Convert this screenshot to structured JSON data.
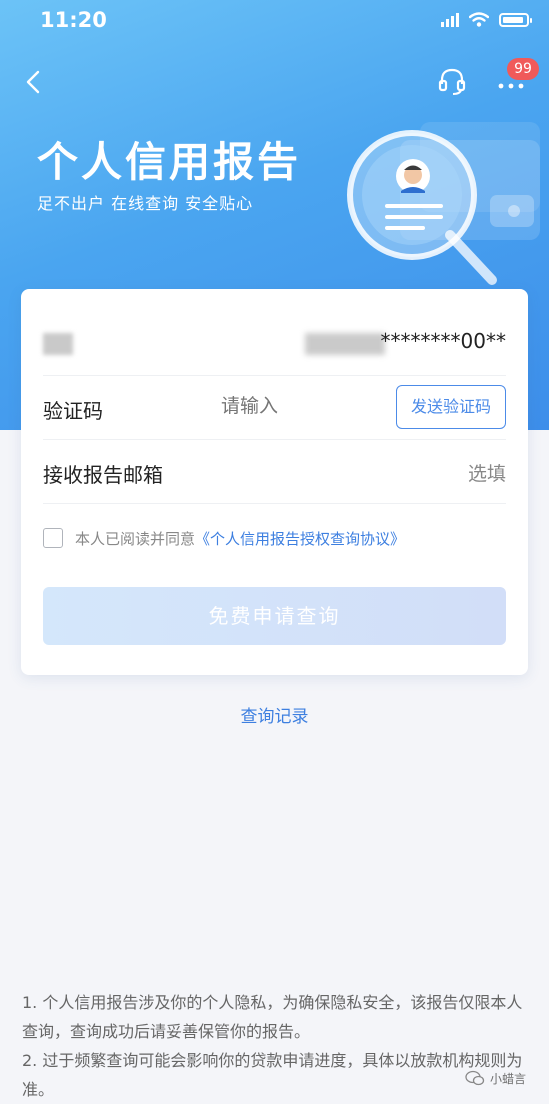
{
  "status": {
    "time": "11:20"
  },
  "nav": {
    "badge": "99"
  },
  "hero": {
    "title": "个人信用报告",
    "subtitle": "足不出户 在线查询 安全贴心"
  },
  "form": {
    "id_masked": "********00**",
    "code_label": "验证码",
    "code_placeholder": "请输入",
    "send_label": "发送验证码",
    "email_label": "接收报告邮箱",
    "email_placeholder": "选填",
    "agree_text": "本人已阅读并同意",
    "agree_link": "《个人信用报告授权查询协议》",
    "submit_label": "免费申请查询"
  },
  "records_label": "查询记录",
  "notes": [
    "1. 个人信用报告涉及你的个人隐私，为确保隐私安全，该报告仅限本人查询，查询成功后请妥善保管你的报告。",
    "2. 过于频繁查询可能会影响你的贷款申请进度，具体以放款机构规则为准。"
  ],
  "watermark": "小蜡言",
  "colors": {
    "accent": "#3d7fe0",
    "badge": "#f05a5a",
    "hero": "#4aa5f0"
  },
  "icons": [
    "back-icon",
    "headset-icon",
    "more-icon",
    "credit-report-illustration",
    "wechat-icon"
  ]
}
